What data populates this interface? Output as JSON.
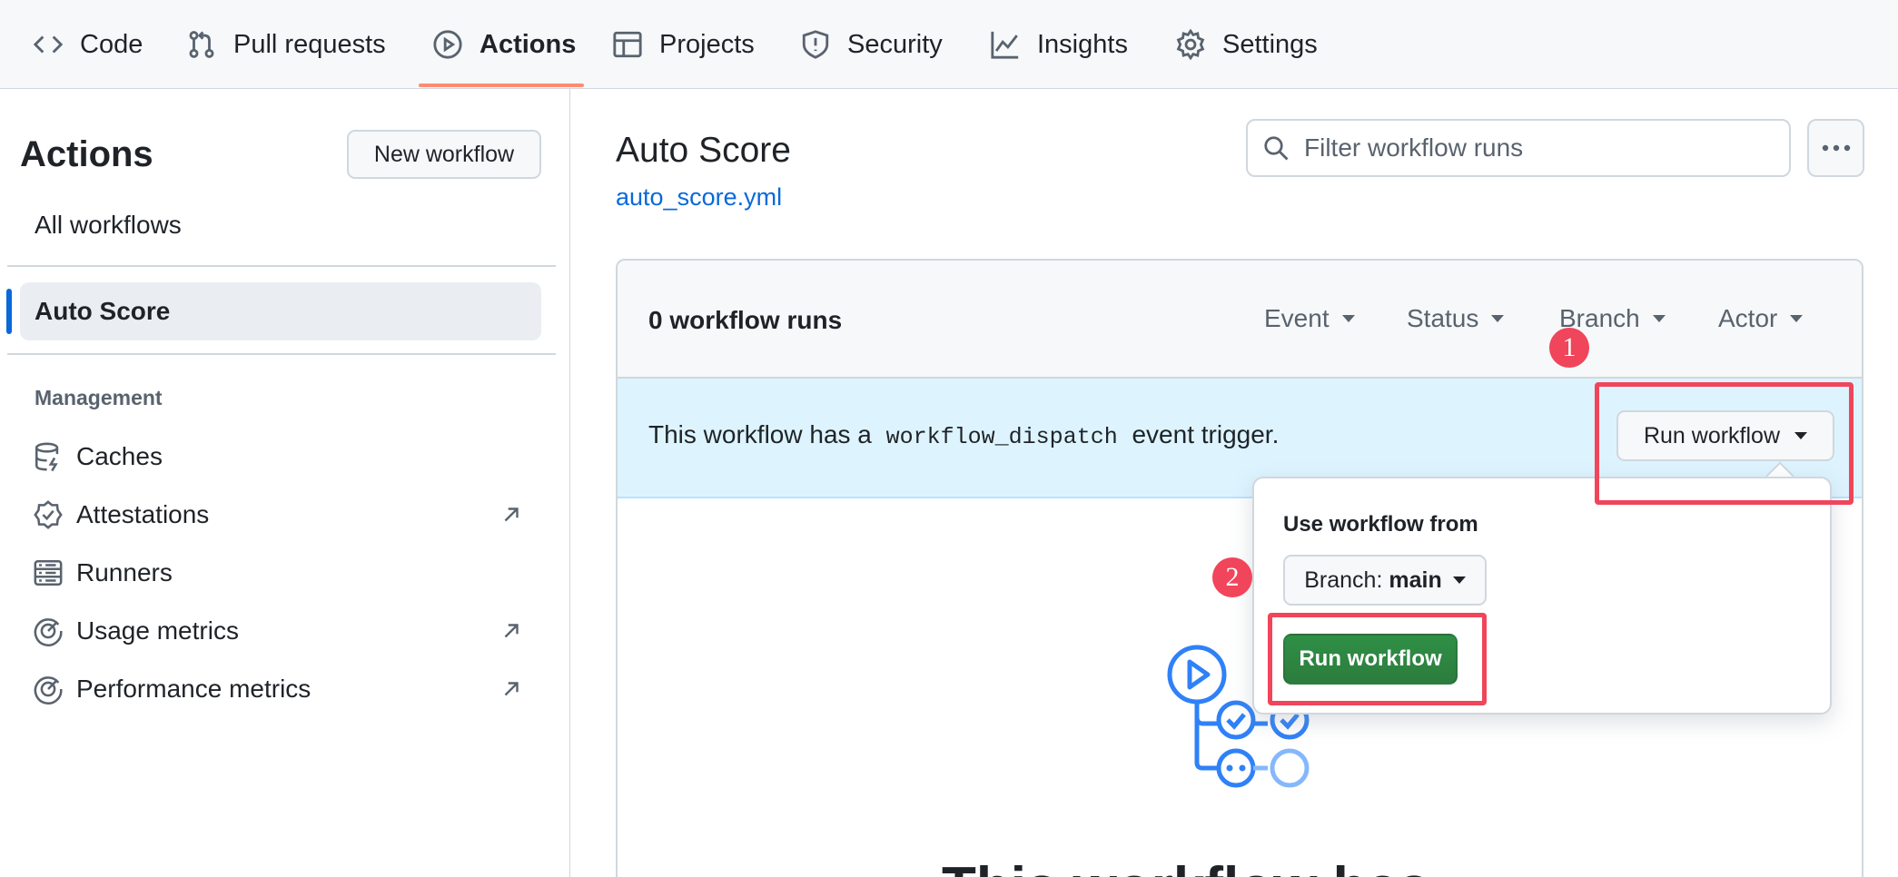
{
  "nav": {
    "tabs": [
      {
        "label": "Code",
        "icon": "code-icon"
      },
      {
        "label": "Pull requests",
        "icon": "pull-request-icon"
      },
      {
        "label": "Actions",
        "icon": "play-icon",
        "active": true
      },
      {
        "label": "Projects",
        "icon": "table-icon"
      },
      {
        "label": "Security",
        "icon": "shield-icon"
      },
      {
        "label": "Insights",
        "icon": "graph-icon"
      },
      {
        "label": "Settings",
        "icon": "gear-icon"
      }
    ],
    "active_underline_color": "#fd8c73"
  },
  "sidebar": {
    "title": "Actions",
    "new_workflow": "New workflow",
    "all_workflows": "All workflows",
    "active_workflow": "Auto Score",
    "section": "Management",
    "items": [
      {
        "label": "Caches",
        "icon": "database-icon",
        "external": false
      },
      {
        "label": "Attestations",
        "icon": "verified-icon",
        "external": true
      },
      {
        "label": "Runners",
        "icon": "server-icon",
        "external": false
      },
      {
        "label": "Usage metrics",
        "icon": "meter-icon",
        "external": true
      },
      {
        "label": "Performance metrics",
        "icon": "meter-icon",
        "external": true
      }
    ]
  },
  "main": {
    "title": "Auto Score",
    "file": "auto_score.yml",
    "search_placeholder": "Filter workflow runs",
    "runs_count": "0 workflow runs",
    "filters": [
      "Event",
      "Status",
      "Branch",
      "Actor"
    ],
    "banner_pre": "This workflow has a",
    "banner_code": "workflow_dispatch",
    "banner_post": "event trigger.",
    "run_button": "Run workflow",
    "heading_partial": "This workflow has"
  },
  "popover": {
    "label": "Use workflow from",
    "branch_prefix": "Branch:",
    "branch_value": "main",
    "submit": "Run workflow"
  },
  "annotations": {
    "markers": [
      "1",
      "2"
    ],
    "color": "#f0455a"
  },
  "colors": {
    "link": "#0969da",
    "banner_bg": "#ddf4ff",
    "primary_green": "#2c7d3d",
    "accent_blue": "#0969da"
  }
}
